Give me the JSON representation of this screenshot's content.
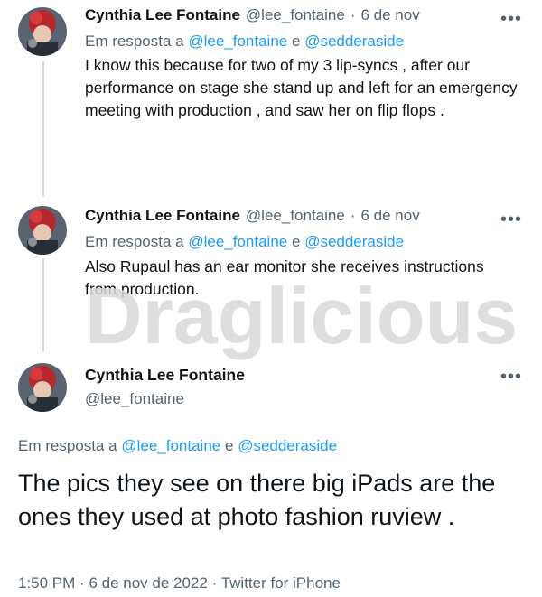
{
  "tweets": [
    {
      "name": "Cynthia Lee Fontaine",
      "handle": "@lee_fontaine",
      "sep": "·",
      "date": "6 de nov",
      "reply_prefix": "Em resposta a",
      "reply_to_1": "@lee_fontaine",
      "reply_joiner": "e",
      "reply_to_2": "@sedderaside",
      "text": "I know this because for two of my 3 lip-syncs , after our performance on stage she stand up and left for an emergency meeting with production , and saw her on flip flops ."
    },
    {
      "name": "Cynthia Lee Fontaine",
      "handle": "@lee_fontaine",
      "sep": "·",
      "date": "6 de nov",
      "reply_prefix": "Em resposta a",
      "reply_to_1": "@lee_fontaine",
      "reply_joiner": "e",
      "reply_to_2": "@sedderaside",
      "text": "Also Rupaul has an ear monitor she receives instructions from production."
    }
  ],
  "main_tweet": {
    "name": "Cynthia Lee Fontaine",
    "handle": "@lee_fontaine",
    "reply_prefix": "Em resposta a",
    "reply_to_1": "@lee_fontaine",
    "reply_joiner": "e",
    "reply_to_2": "@sedderaside",
    "text": "The pics they see on there big iPads are the ones they used at photo fashion ruview .",
    "time": "1:50 PM",
    "sep": "·",
    "date": "6 de nov de 2022",
    "source": "Twitter for iPhone"
  },
  "more_glyph": "•••",
  "watermark_text": "Draglicious",
  "colors": {
    "text": "#0f1419",
    "muted": "#536471",
    "link": "#1d9bf0",
    "line": "#cfd9de"
  },
  "icons": {
    "more": "more-horizontal-icon"
  }
}
